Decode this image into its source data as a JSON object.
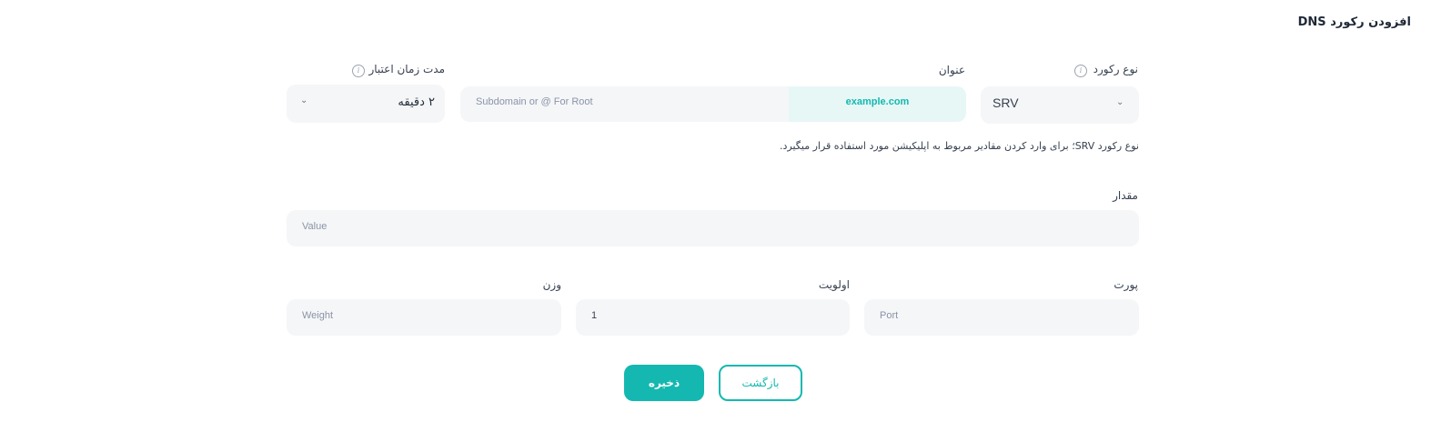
{
  "header": {
    "title": "افزودن رکورد DNS"
  },
  "record_type": {
    "label": "نوع رکورد",
    "value": "SRV"
  },
  "name": {
    "label": "عنوان",
    "domain_suffix": "example.com",
    "placeholder": "Subdomain or @ For Root"
  },
  "ttl": {
    "label": "مدت زمان اعتبار",
    "value": "۲ دقیقه"
  },
  "hint": "نوع رکورد SRV؛ برای وارد کردن مقادیر مربوط به اپلیکیشن مورد استفاده قرار میگیرد.",
  "value_field": {
    "label": "مقدار",
    "placeholder": "Value"
  },
  "port": {
    "label": "پورت",
    "placeholder": "Port"
  },
  "priority": {
    "label": "اولویت",
    "value": "1"
  },
  "weight": {
    "label": "وزن",
    "placeholder": "Weight"
  },
  "actions": {
    "save_label": "ذخیره",
    "back_label": "بازگشت"
  },
  "colors": {
    "accent": "#14b8b0",
    "domain_bg": "#e6f7f6",
    "field_bg": "#f5f6f8"
  }
}
